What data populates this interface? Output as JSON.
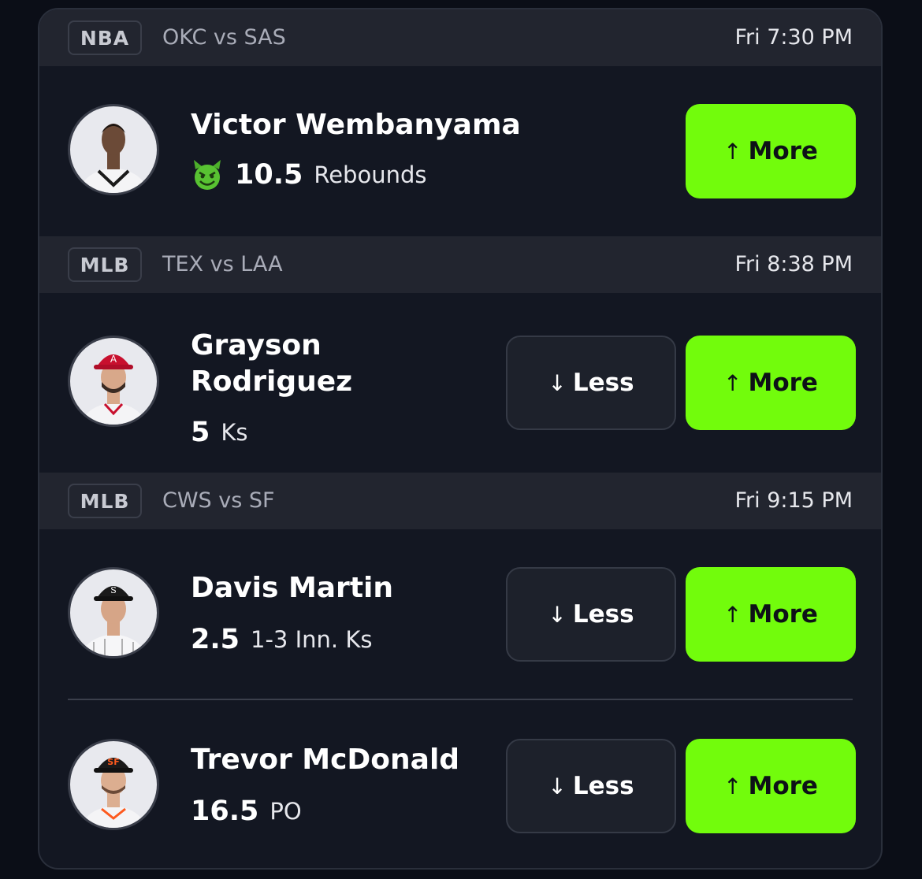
{
  "games": [
    {
      "league": "NBA",
      "matchup": "OKC vs SAS",
      "time": "Fri 7:30 PM",
      "players": [
        {
          "name": "Victor Wembanyama",
          "line": "10.5",
          "stat": "Rebounds",
          "icon": "devil-emoji-icon",
          "less_label": null,
          "more_label": "More"
        }
      ]
    },
    {
      "league": "MLB",
      "matchup": "TEX vs LAA",
      "time": "Fri 8:38 PM",
      "players": [
        {
          "name": "Grayson Rodriguez",
          "line": "5",
          "stat": "Ks",
          "less_label": "Less",
          "more_label": "More"
        }
      ]
    },
    {
      "league": "MLB",
      "matchup": "CWS vs SF",
      "time": "Fri 9:15 PM",
      "players": [
        {
          "name": "Davis Martin",
          "line": "2.5",
          "stat": "1-3 Inn. Ks",
          "less_label": "Less",
          "more_label": "More"
        },
        {
          "name": "Trevor McDonald",
          "line": "16.5",
          "stat": "PO",
          "less_label": "Less",
          "more_label": "More"
        }
      ]
    }
  ],
  "arrows": {
    "up": "↑",
    "down": "↓"
  },
  "colors": {
    "more_button": "#72fc0c",
    "card_background": "#131722",
    "header_background": "#22252f",
    "page_background": "#0b0e17"
  }
}
